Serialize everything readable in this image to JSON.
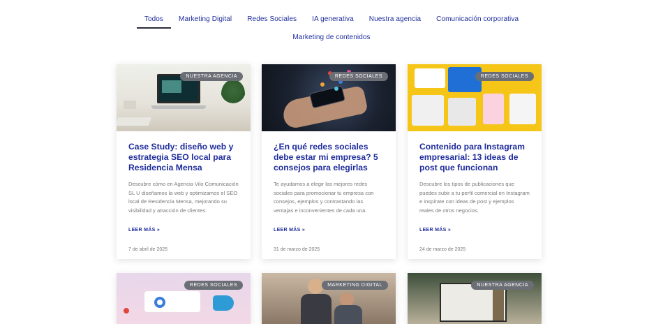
{
  "filters": {
    "row1": [
      "Todos",
      "Marketing Digital",
      "Redes Sociales",
      "IA generativa",
      "Nuestra agencia",
      "Comunicación corporativa"
    ],
    "row2": [
      "Marketing de contenidos"
    ],
    "active": "Todos"
  },
  "cards": [
    {
      "badge": "Nuestra agencia",
      "title": "Case Study: diseño web y estrategia SEO local para Residencia Mensa",
      "excerpt": "Descubre cómo en Agencia Vilo Comunicación SL U diseñamos la web y optimizamos el SEO local de Residencia Mensa, mejorando su visibilidad y atracción de clientes.",
      "read_more": "LEER MÁS »",
      "date": "7 de abril de 2025"
    },
    {
      "badge": "Redes Sociales",
      "title": "¿En qué redes sociales debe estar mi empresa? 5 consejos para elegirlas",
      "excerpt": "Te ayudamos a elegir las mejores redes sociales para promocionar tu empresa con consejos, ejemplos y contrastando las ventajas e inconvenientes de cada una.",
      "read_more": "LEER MÁS »",
      "date": "31 de marzo de 2025"
    },
    {
      "badge": "Redes Sociales",
      "title": "Contenido para Instagram empresarial: 13 ideas de post que funcionan",
      "excerpt": "Descubre los tipos de publicaciones que puedes subir a tu perfil comercial en Instagram e inspírate con ideas de post y ejemplos reales de otros negocios.",
      "read_more": "LEER MÁS »",
      "date": "24 de marzo de 2025"
    },
    {
      "badge": "Redes Sociales"
    },
    {
      "badge": "Marketing Digital"
    },
    {
      "badge": "Nuestra agencia"
    }
  ]
}
